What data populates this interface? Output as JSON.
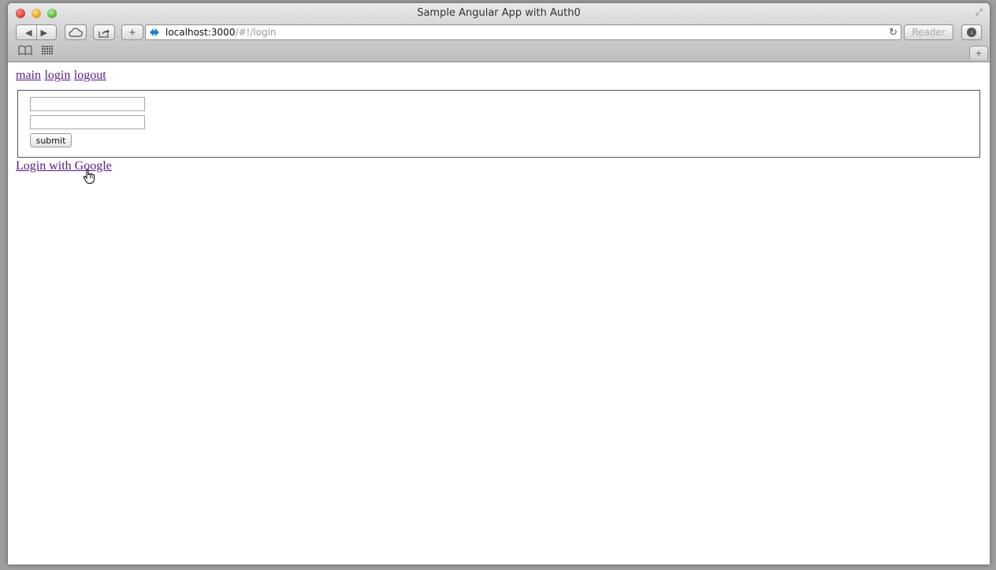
{
  "window": {
    "title": "Sample Angular App with Auth0"
  },
  "toolbar": {
    "back_icon": "back-arrow-icon",
    "forward_icon": "forward-arrow-icon",
    "icloud_icon": "cloud-icon",
    "share_icon": "share-icon",
    "new_tab_label": "+",
    "url_host": "localhost:3000",
    "url_path": "/#!/login",
    "reader_label": "Reader"
  },
  "bookmarks": {
    "add_tab_label": "+"
  },
  "page": {
    "nav_links": [
      "main",
      "login",
      "logout"
    ],
    "username_value": "",
    "password_value": "",
    "submit_label": "submit",
    "google_link": "Login with Google"
  }
}
